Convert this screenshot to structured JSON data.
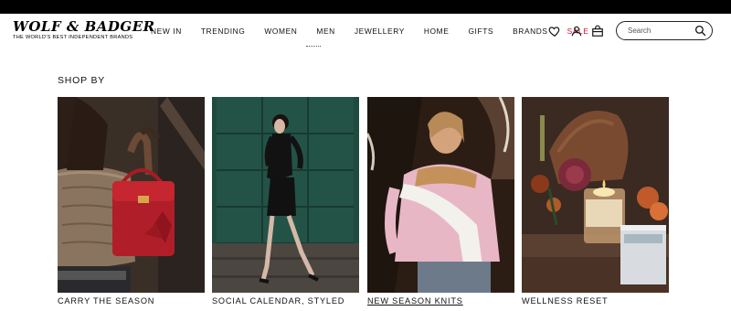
{
  "brand": {
    "name": "WOLF & BADGER",
    "tagline": "THE WORLD'S BEST INDEPENDENT BRANDS"
  },
  "nav": {
    "items": [
      "NEW IN",
      "TRENDING",
      "WOMEN",
      "MEN",
      "JEWELLERY",
      "HOME",
      "GIFTS",
      "BRANDS"
    ],
    "sale": "SALE",
    "sale_color": "#c8102e"
  },
  "icons": [
    "heart-icon",
    "user-icon",
    "bag-icon",
    "search-icon"
  ],
  "search": {
    "placeholder": "Search"
  },
  "section": {
    "title": "SHOP BY"
  },
  "cards": [
    {
      "label": "CARRY THE SEASON",
      "image": "model holding red handbag"
    },
    {
      "label": "SOCIAL CALENDAR, STYLED",
      "image": "model walking in black dress"
    },
    {
      "label": "NEW SEASON KNITS",
      "image": "man in pink cardigan"
    },
    {
      "label": "WELLNESS RESET",
      "image": "candle and autumn still life"
    }
  ]
}
